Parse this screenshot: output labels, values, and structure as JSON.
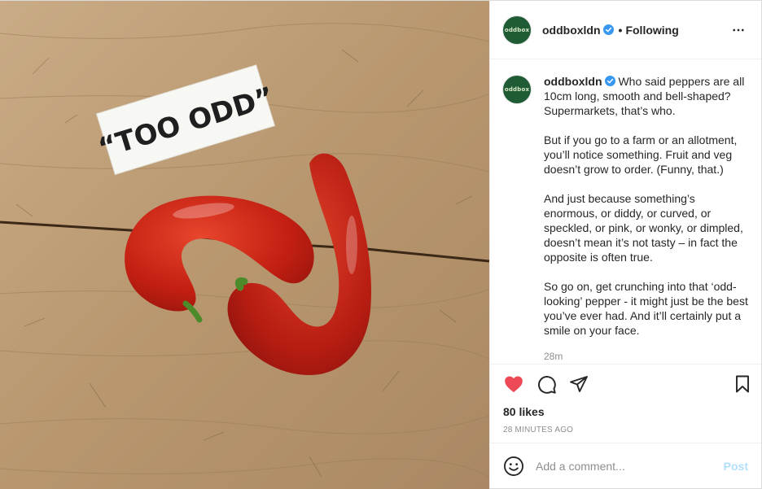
{
  "post": {
    "image_alt": "Two curved red peppers on a wooden table next to a card reading TOO ODD",
    "card_text": "“TOO ODD”"
  },
  "header": {
    "username": "oddboxldn",
    "avatar_text": "oddbox",
    "separator": "•",
    "follow_status": "Following",
    "more_icon": "more-horizontal-icon"
  },
  "caption": {
    "username": "oddboxldn",
    "paragraphs": [
      "Who said peppers are all 10cm long, smooth and bell-shaped? Supermarkets, that’s who.",
      "But if you go to a farm or an allotment, you’ll notice something. Fruit and veg doesn’t grow to order. (Funny, that.)",
      "And just because something’s enormous, or diddy, or curved, or speckled, or pink, or wonky, or dimpled, doesn’t mean it’s not tasty – in fact the opposite is often true.",
      "So go on, get crunching into that ‘odd-looking’ pepper - it might just be the best you’ve ever had. And it’ll certainly put a smile on your face."
    ],
    "time": "28m"
  },
  "actions": {
    "like_icon": "heart-filled-icon",
    "comment_icon": "comment-icon",
    "share_icon": "share-icon",
    "save_icon": "bookmark-icon",
    "liked": true
  },
  "likes": "80 likes",
  "timestamp": "28 MINUTES AGO",
  "comment_box": {
    "emoji_icon": "emoji-icon",
    "placeholder": "Add a comment...",
    "post_label": "Post"
  },
  "colors": {
    "brand_avatar": "#1f5b35",
    "like_red": "#ed4956",
    "verified_blue": "#3897f0",
    "post_disabled": "#b2dffc",
    "meta_gray": "#8e8e8e"
  }
}
